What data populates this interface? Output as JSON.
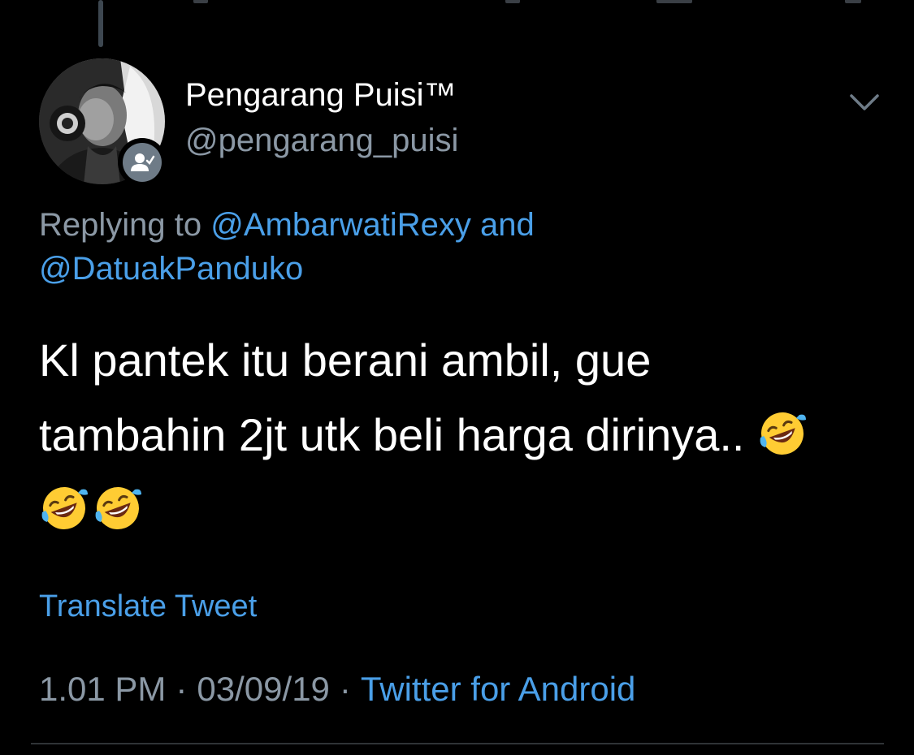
{
  "tweet": {
    "display_name": "Pengarang Puisi™",
    "handle": "@pengarang_puisi",
    "replying_prefix": "Replying to ",
    "reply_mentions": [
      "@AmbarwatiRexy",
      "@DatuakPanduko"
    ],
    "reply_conjunction": " and ",
    "text_line1": "Kl pantek itu berani ambil, gue",
    "text_line2": "tambahin 2jt utk beli harga dirinya.. ",
    "emoji": "rolling-on-the-floor-laughing",
    "translate_label": "Translate Tweet",
    "time": "1.01 PM",
    "date": "03/09/19",
    "separator": "·",
    "source": "Twitter for Android"
  },
  "icons": {
    "more": "chevron-down-icon",
    "badge": "follows-you-person-icon",
    "emoji": "rofl-emoji-icon"
  },
  "colors": {
    "background": "#000000",
    "primary_text": "#ffffff",
    "secondary_text": "#8b98a5",
    "link": "#4a9fe8"
  }
}
